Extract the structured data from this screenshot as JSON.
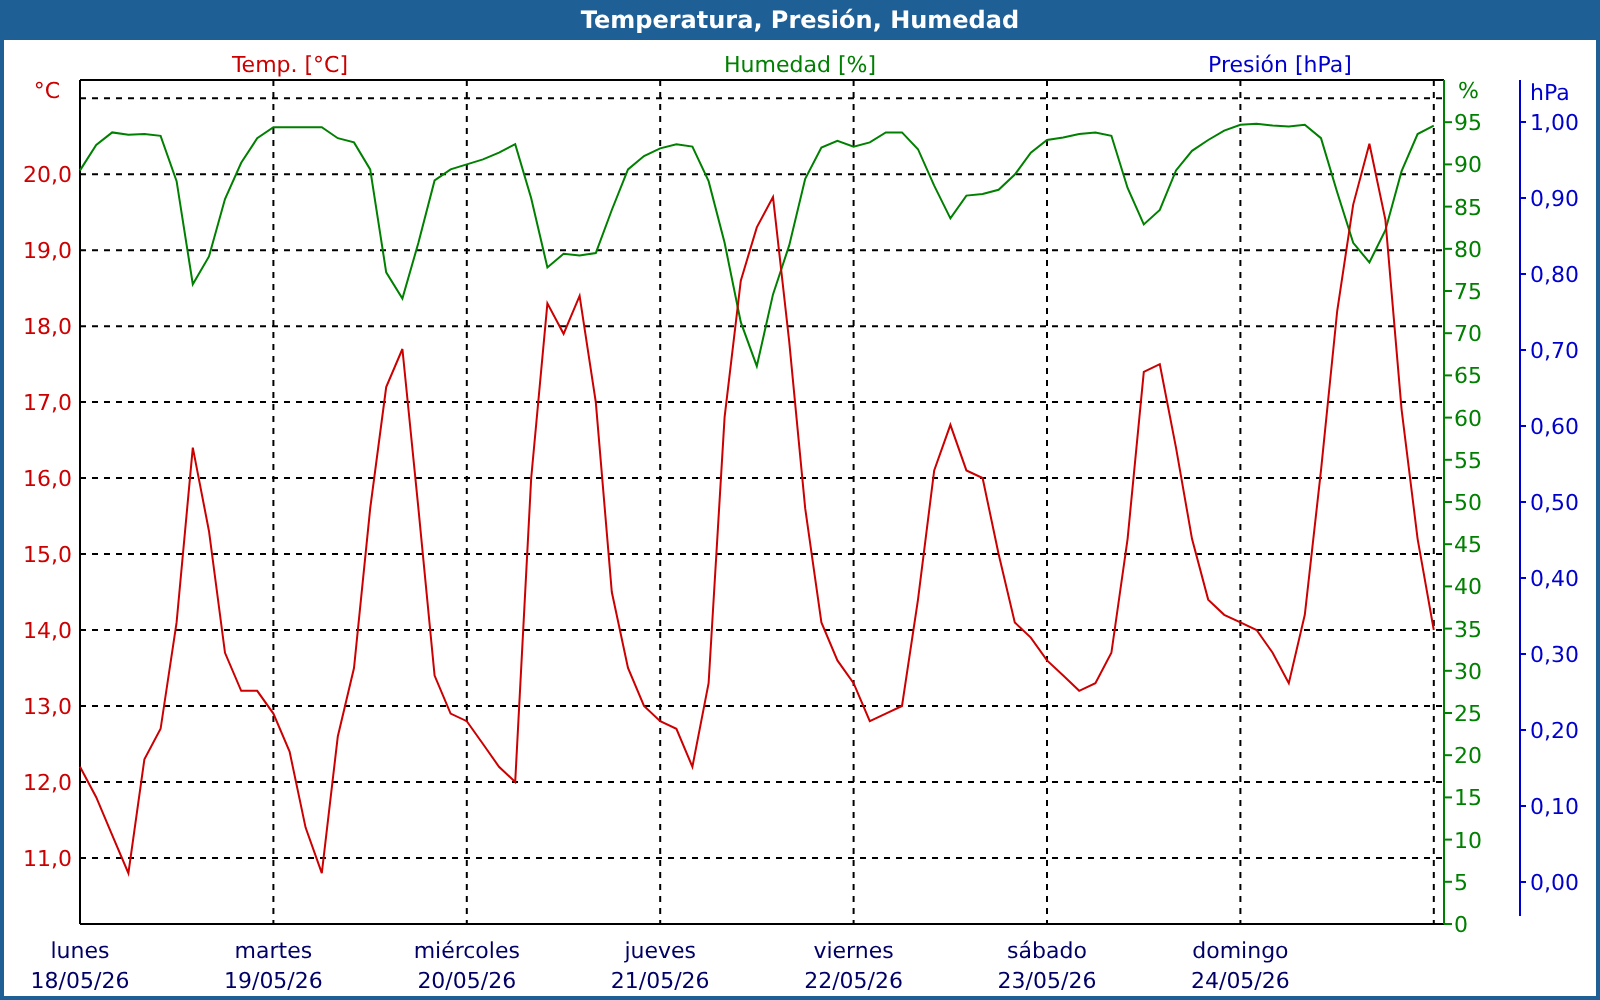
{
  "window": {
    "title": "Temperatura, Presión, Humedad"
  },
  "chart": {
    "temperature": {
      "chart_data": {
        "type": "line",
        "ylabel": "°C",
        "categories": [
          "lunes",
          null,
          null,
          null,
          null,
          null,
          null,
          null,
          null,
          null,
          null,
          null,
          "martes",
          null,
          null,
          null,
          null,
          null,
          null,
          null,
          null,
          null,
          null,
          null,
          "miércoles",
          null,
          null,
          null,
          null,
          null,
          null,
          null,
          null,
          null,
          null,
          null,
          "jueves",
          null,
          null,
          null,
          null,
          null,
          null,
          null,
          null,
          null,
          null,
          null,
          "viernes",
          null,
          null,
          null,
          null,
          null,
          null,
          null,
          null,
          null,
          null,
          null,
          "sábado",
          null,
          null,
          null,
          null,
          null,
          null,
          null,
          null,
          null,
          null,
          null,
          "domingo",
          null,
          null,
          null,
          null,
          null,
          null,
          null,
          null,
          null,
          null,
          null,
          null
        ],
        "series": [
          {
            "name": "Temp. [°C]",
            "color": "#cc0000",
            "values": [
              12.2,
              11.8,
              11.3,
              10.8,
              12.3,
              12.7,
              14.1,
              16.4,
              15.3,
              13.7,
              13.2,
              13.2,
              12.9,
              12.4,
              11.4,
              10.8,
              12.6,
              13.5,
              15.6,
              17.2,
              17.7,
              15.6,
              13.4,
              12.9,
              12.8,
              12.5,
              12.2,
              12.0,
              16.0,
              18.3,
              17.9,
              18.4,
              17.0,
              14.5,
              13.5,
              13.0,
              12.8,
              12.7,
              12.2,
              13.3,
              16.8,
              18.6,
              19.3,
              19.7,
              17.8,
              15.6,
              14.1,
              13.6,
              13.3,
              12.8,
              12.9,
              13.0,
              14.4,
              16.1,
              16.7,
              16.1,
              16.0,
              15.0,
              14.1,
              13.9,
              13.6,
              13.4,
              13.2,
              13.3,
              13.7,
              15.2,
              17.4,
              17.5,
              16.4,
              15.2,
              14.4,
              14.2,
              14.1,
              14.0,
              13.7,
              13.3,
              14.2,
              16.1,
              18.2,
              19.6,
              20.4,
              19.4,
              16.9,
              15.2,
              14.0
            ]
          }
        ],
        "ylim": [
          10.13,
          21.24
        ],
        "yticks": [
          {
            "value": 11,
            "label": "11,0"
          },
          {
            "value": 12,
            "label": "12,0"
          },
          {
            "value": 13,
            "label": "13,0"
          },
          {
            "value": 14,
            "label": "14,0"
          },
          {
            "value": 15,
            "label": "15,0"
          },
          {
            "value": 16,
            "label": "16,0"
          },
          {
            "value": 17,
            "label": "17,0"
          },
          {
            "value": 18,
            "label": "18,0"
          },
          {
            "value": 19,
            "label": "19,0"
          },
          {
            "value": 20,
            "label": "20,0"
          }
        ]
      }
    },
    "humidity": {
      "chart_data": {
        "type": "line",
        "ylabel": "%",
        "series": [
          {
            "name": "Humedad [%]",
            "color": "#008000",
            "values": [
              89.3,
              92.3,
              93.8,
              93.5,
              93.6,
              93.4,
              88.0,
              75.8,
              79.1,
              85.9,
              90.2,
              93.1,
              94.4,
              94.4,
              94.4,
              94.4,
              93.1,
              92.6,
              89.4,
              77.2,
              74.1,
              80.7,
              88.1,
              89.4,
              90.0,
              90.6,
              91.4,
              92.4,
              86.0,
              77.8,
              79.4,
              79.2,
              79.5,
              84.6,
              89.4,
              91.0,
              91.9,
              92.4,
              92.1,
              88.0,
              80.7,
              71.3,
              66.1,
              74.6,
              80.4,
              88.3,
              92.0,
              92.8,
              92.1,
              92.6,
              93.8,
              93.8,
              91.8,
              87.5,
              83.6,
              86.3,
              86.5,
              87.0,
              88.8,
              91.4,
              92.9,
              93.2,
              93.6,
              93.8,
              93.4,
              87.2,
              82.9,
              84.6,
              89.3,
              91.6,
              92.9,
              94.0,
              94.7,
              94.8,
              94.6,
              94.5,
              94.7,
              93.1,
              86.7,
              80.7,
              78.4,
              82.2,
              89.2,
              93.6,
              94.6
            ]
          }
        ],
        "ylim": [
          0,
          100
        ],
        "yticks": [
          0,
          5,
          10,
          15,
          20,
          25,
          30,
          35,
          40,
          45,
          50,
          55,
          60,
          65,
          70,
          75,
          80,
          85,
          90,
          95
        ]
      }
    },
    "dates": [
      "18/05/26",
      "19/05/26",
      "20/05/26",
      "21/05/26",
      "22/05/26",
      "23/05/26",
      "24/05/26"
    ],
    "pressure_axis": {
      "title": "Presión [hPa]",
      "unit": "hPa",
      "ticks": [
        "1,00",
        "0,90",
        "0,80",
        "0,70",
        "0,60",
        "0,50",
        "0,40",
        "0,30",
        "0,20",
        "0,10",
        "0,00"
      ]
    }
  }
}
